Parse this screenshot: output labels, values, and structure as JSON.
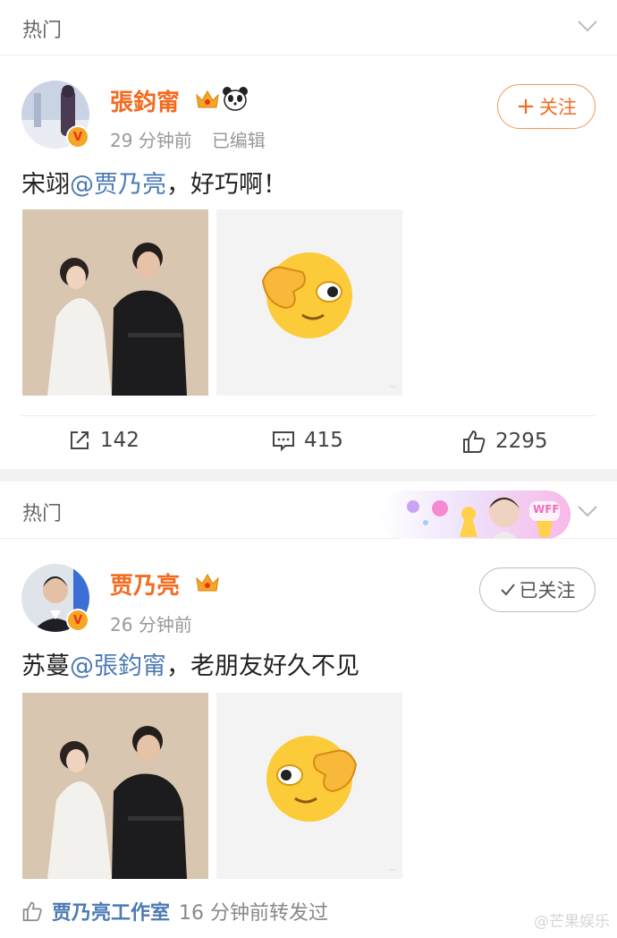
{
  "section1": {
    "header": "热门"
  },
  "post1": {
    "username": "張鈞甯",
    "time": "29 分钟前",
    "edited": "已编辑",
    "follow_label": "关注",
    "text_before": "宋翊",
    "mention": "@贾乃亮",
    "text_after": "，好巧啊！",
    "actions": {
      "repost": "142",
      "comment": "415",
      "like": "2295"
    }
  },
  "section2": {
    "header": "热门",
    "banner_badge": "WFF"
  },
  "post2": {
    "username": "贾乃亮",
    "time": "26 分钟前",
    "follow_label": "已关注",
    "text_before": "苏蔓",
    "mention": "@張鈞甯",
    "text_after": "，老朋友好久不见"
  },
  "repost_line": {
    "who": "贾乃亮工作室",
    "text": "16 分钟前转发过"
  },
  "watermark": "@芒果娱乐",
  "colors": {
    "username": "#f26b1f",
    "mention": "#4b7ab3",
    "crown": "#f5a623"
  }
}
